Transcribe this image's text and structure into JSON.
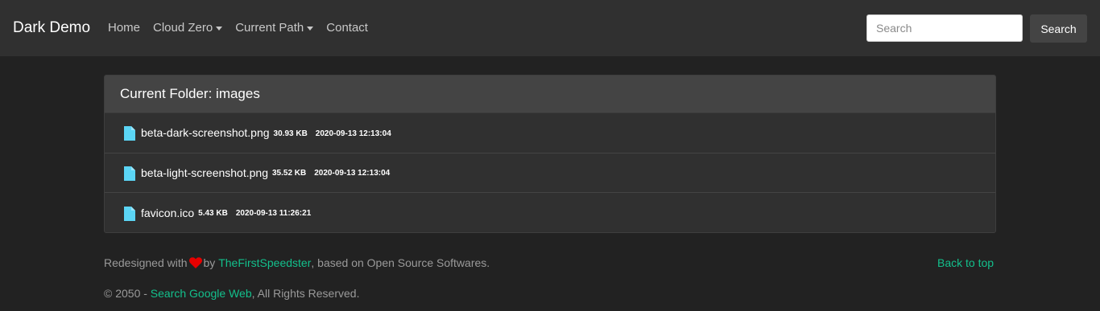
{
  "navbar": {
    "brand": "Dark Demo",
    "links": [
      {
        "label": "Home",
        "dropdown": false
      },
      {
        "label": "Cloud Zero",
        "dropdown": true
      },
      {
        "label": "Current Path",
        "dropdown": true
      },
      {
        "label": "Contact",
        "dropdown": false
      }
    ],
    "search": {
      "placeholder": "Search",
      "value": "",
      "button_label": "Search"
    }
  },
  "folder": {
    "title": "Current Folder: images",
    "files": [
      {
        "name": "beta-dark-screenshot.png",
        "size": "30.93 KB",
        "modified": "2020-09-13 12:13:04",
        "icon": "file-icon"
      },
      {
        "name": "beta-light-screenshot.png",
        "size": "35.52 KB",
        "modified": "2020-09-13 12:13:04",
        "icon": "file-icon"
      },
      {
        "name": "favicon.ico",
        "size": "5.43 KB",
        "modified": "2020-09-13 11:26:21",
        "icon": "file-icon"
      }
    ]
  },
  "footer": {
    "redesigned_prefix": "Redesigned with",
    "by_text": "by",
    "author_link": "TheFirstSpeedster",
    "suffix": ", based on Open Source Softwares.",
    "back_to_top": "Back to top",
    "copyright_prefix": "© 2050 -",
    "copyright_link": "Search Google Web",
    "copyright_suffix": ", All Rights Reserved."
  },
  "colors": {
    "background": "#222222",
    "navbar": "#303030",
    "card_header": "#444444",
    "accent": "#13c08c",
    "file_icon": "#5bd5f5",
    "heart": "#e60000"
  }
}
